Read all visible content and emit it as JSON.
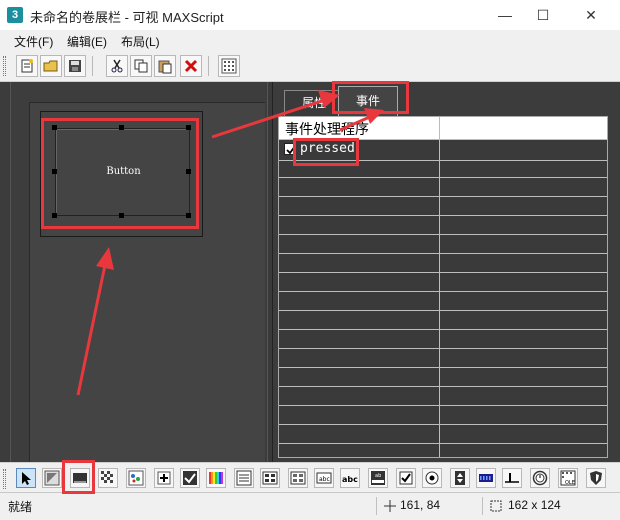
{
  "window": {
    "app_icon_text": "3",
    "title": "未命名的卷展栏 - 可视 MAXScript",
    "minimize": "—",
    "maximize": "☐",
    "close": "✕"
  },
  "menu": {
    "items": [
      {
        "label": "文件(F)"
      },
      {
        "label": "编辑(E)"
      },
      {
        "label": "布局(L)"
      }
    ]
  },
  "editor": {
    "button_caption": "Button"
  },
  "tabs": [
    {
      "label": "属性"
    },
    {
      "label": "事件"
    }
  ],
  "event_grid": {
    "header": "事件处理程序",
    "rows": [
      {
        "checked": true,
        "label": "pressed"
      }
    ]
  },
  "status": {
    "text": "就绪",
    "position": "161, 84",
    "size": "162 x 124"
  },
  "colors": {
    "annotation": "#e8383d",
    "panel_bg": "#3c3c3c",
    "chrome": "#f0f0f0"
  }
}
